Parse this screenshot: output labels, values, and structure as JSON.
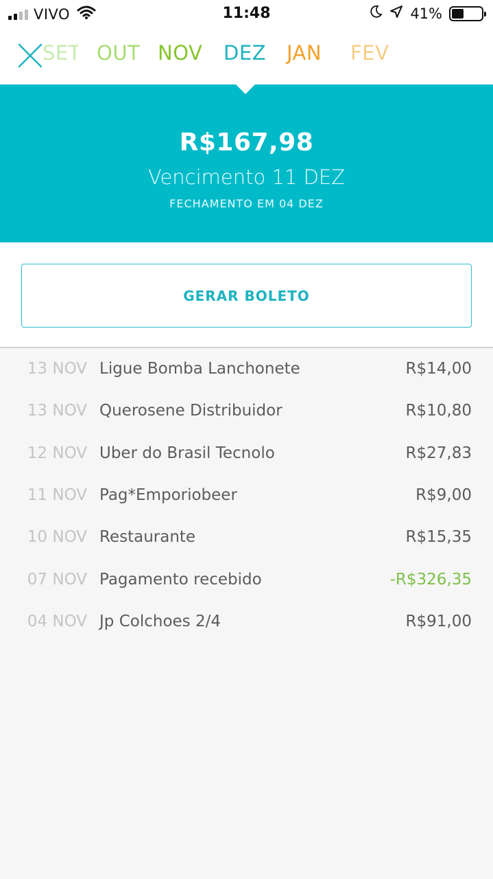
{
  "status_bar": {
    "carrier": "VIVO",
    "time": "11:48",
    "battery": "41%",
    "battery_level": 0.41,
    "icons": [
      "signal-icon",
      "wifi-icon",
      "moon-icon",
      "location-icon",
      "battery-icon"
    ]
  },
  "nav": {
    "close_icon": "close-icon",
    "months": [
      {
        "label": "SET",
        "color": "#c8ebb0"
      },
      {
        "label": "OUT",
        "color": "#a9dc74"
      },
      {
        "label": "NOV",
        "color": "#86c42f"
      },
      {
        "label": "DEZ",
        "color": "#1fb3c1"
      },
      {
        "label": "JAN",
        "color": "#f3a12a"
      },
      {
        "label": "FEV",
        "color": "#f7cc85"
      }
    ]
  },
  "summary": {
    "amount": "R$167,98",
    "due": "Vencimento 11 DEZ",
    "closing": "FECHAMENTO EM 04 DEZ",
    "color": "#00bac8"
  },
  "actions": {
    "boleto_label": "GERAR BOLETO"
  },
  "transactions": [
    {
      "date": "13 NOV",
      "description": "Ligue Bomba Lanchonete",
      "amount": "R$14,00"
    },
    {
      "date": "13 NOV",
      "description": "Querosene Distribuidor",
      "amount": "R$10,80"
    },
    {
      "date": "12 NOV",
      "description": "Uber do Brasil Tecnolo",
      "amount": "R$27,83"
    },
    {
      "date": "11 NOV",
      "description": "Pag*Emporiobeer",
      "amount": "R$9,00"
    },
    {
      "date": "10 NOV",
      "description": "Restaurante",
      "amount": "R$15,35"
    },
    {
      "date": "07 NOV",
      "description": "Pagamento recebido",
      "amount": "-R$326,35",
      "color": "#7dc04a"
    },
    {
      "date": "04 NOV",
      "description": "Jp Colchoes 2/4",
      "amount": "R$91,00"
    }
  ]
}
